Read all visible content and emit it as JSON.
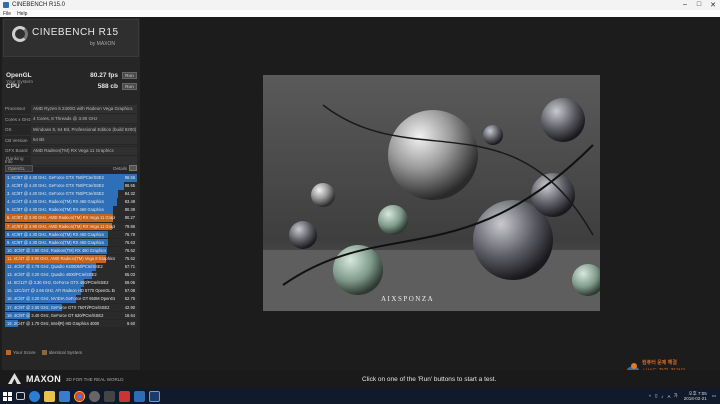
{
  "window": {
    "title": "CINEBENCH R15.0"
  },
  "menu": [
    "File",
    "Help"
  ],
  "logo": {
    "name": "CINEBENCH R15",
    "sub": "by MAXON"
  },
  "scores": [
    {
      "label": "OpenGL",
      "value": "80.27 fps",
      "run": "Run"
    },
    {
      "label": "CPU",
      "value": "588 cb",
      "run": "Run"
    }
  ],
  "system": {
    "title": "Your System",
    "rows": [
      {
        "k": "Processor",
        "v": "AMD Ryzen 5 2400G with Radeon Vega Graphics"
      },
      {
        "k": "Cores x GHz",
        "v": "4 Cores, 8 Threads @ 3.90 GHz"
      },
      {
        "k": "OS",
        "v": "Windows 8, 64 Bit, Professional Edition (build 9200)"
      },
      {
        "k": "CB Version",
        "v": "64 Bit"
      },
      {
        "k": "GFX Board",
        "v": "AMD Radeon(TM) RX Vega 11 Graphics"
      },
      {
        "k": "Info",
        "v": ""
      }
    ]
  },
  "ranking": {
    "title": "Ranking",
    "selector": "OpenGL",
    "details": "Details",
    "items": [
      {
        "t": "1. 6C/6T @ 4.30 GHz, GeForce GTX 750/PCIe/SSE2",
        "s": "98.56",
        "color": "#2f6fb8"
      },
      {
        "t": "2. 4C/8T @ 4.20 GHz, GeForce GTX 750/PCIe/SSE2",
        "s": "88.65",
        "color": "#2f6fb8"
      },
      {
        "t": "3. 4C/8T @ 4.20 GHz, GeForce GTX 750/PCIe/SSE2",
        "s": "84.32",
        "color": "#2f6fb8"
      },
      {
        "t": "4. 4C/4T @ 4.30 GHz, Radeon(TM) RX 460 Graphics",
        "s": "83.49",
        "color": "#2f6fb8"
      },
      {
        "t": "5. 4C/8T @ 4.30 GHz, Radeon(TM) RX 460 Graphics",
        "s": "80.39",
        "color": "#2f6fb8"
      },
      {
        "t": "6. 4C/8T @ 3.90 GHz, AMD Radeon(TM) RX Vega 11 Graphics",
        "s": "80.27",
        "color": "#c8641a"
      },
      {
        "t": "7. 4C/8T @ 3.90 GHz, AMD Radeon(TM) RX Vega 11 Graphics",
        "s": "79.86",
        "color": "#c8641a"
      },
      {
        "t": "8. 4C/8T @ 4.30 GHz, Radeon(TM) RX 460 Graphics",
        "s": "76.79",
        "color": "#2f6fb8"
      },
      {
        "t": "9. 4C/8T @ 4.30 GHz, Radeon(TM) RX 460 Graphics",
        "s": "76.63",
        "color": "#2f6fb8"
      },
      {
        "t": "10. 4C/8T @ 3.80 GHz, Radeon(TM) RX 460 Graphics",
        "s": "76.52",
        "color": "#2f6fb8"
      },
      {
        "t": "11. 4C/4T @ 3.90 GHz, AMD Radeon(TM) Vega 8 Graphics",
        "s": "75.52",
        "color": "#c8641a"
      },
      {
        "t": "12. 4C/8T @ 2.79 GHz, Quadro K4000M/PCIe/SSE2",
        "s": "67.71",
        "color": "#2f6fb8"
      },
      {
        "t": "13. 4C/8T @ 3.20 GHz, Quadro 4000/PCIe/SSE2",
        "s": "65.03",
        "color": "#2f6fb8"
      },
      {
        "t": "14. 6C/12T @ 3.30 GHz, GeForce GTX 460/PCIe/SSE2",
        "s": "59.06",
        "color": "#2f6fb8"
      },
      {
        "t": "15. 12C/24T @ 2.66 GHz, ATI Radeon HD 5770 OpenGL Engine",
        "s": "57.08",
        "color": "#2f6fb8"
      },
      {
        "t": "16. 4C/8T @ 3.20 GHz, NVIDIA GeForce GT 650M OpenGL Engine",
        "s": "52.75",
        "color": "#2f6fb8"
      },
      {
        "t": "17. 4C/8T @ 2.60 GHz, GeForce GTX 750Ti/PCIe/SSE2",
        "s": "42.90",
        "color": "#2f6fb8"
      },
      {
        "t": "18. 4C/8T @ 3.40 GHz, GeForce GT 620/PCIe/SSE2",
        "s": "18.64",
        "color": "#2f6fb8"
      },
      {
        "t": "19. 2C/4T @ 1.70 GHz, Intel(R) HD Graphics 4000",
        "s": "9.60",
        "color": "#2f6fb8"
      }
    ]
  },
  "legend": [
    {
      "label": "Your Score",
      "color": "#c8641a"
    },
    {
      "label": "Identical System",
      "color": "#8a6a3a"
    }
  ],
  "brand": {
    "name": "MAXON",
    "tagline": "3D FOR THE REAL WORLD"
  },
  "status": "Click on one of the 'Run' buttons to start a test.",
  "render": {
    "caption": "AIXSPONZA"
  },
  "watermark": {
    "line1": "컴퓨터 문제 해결",
    "line2": "서산돈 향한 첫걸음"
  },
  "taskbar": {
    "lang": "A",
    "ime": "가",
    "time": "오후 7:05",
    "date": "2018-02-21"
  }
}
